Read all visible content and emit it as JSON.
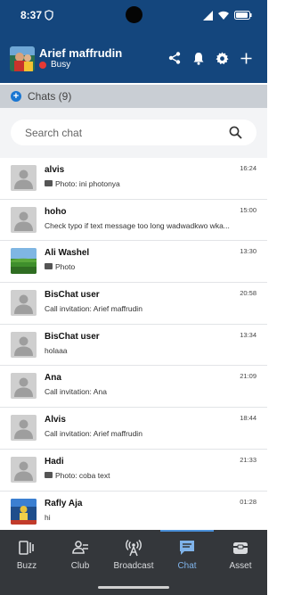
{
  "status_bar": {
    "time": "8:37",
    "battery_icon": "battery-icon",
    "wifi_icon": "wifi-icon",
    "signal_icon": "signal-icon"
  },
  "user": {
    "name": "Arief maffrudin",
    "presence": "Busy",
    "presence_color": "#e53935"
  },
  "app_bar_icons": [
    "share-icon",
    "bell-icon",
    "gear-icon",
    "plus-icon"
  ],
  "section": {
    "label": "Chats (9)"
  },
  "search": {
    "placeholder": "Search chat",
    "value": ""
  },
  "chats": [
    {
      "name": "alvis",
      "preview": "Photo: ini photonya",
      "time": "16:24",
      "has_photo_icon": true,
      "avatar": "default"
    },
    {
      "name": "hoho",
      "preview": "Check typo if text message too long wadwadkwo wka...",
      "time": "15:00",
      "has_photo_icon": false,
      "avatar": "default"
    },
    {
      "name": "Ali Washel",
      "preview": "Photo",
      "time": "13:30",
      "has_photo_icon": true,
      "avatar": "landscape"
    },
    {
      "name": "BisChat user",
      "preview": "Call invitation: Arief maffrudin",
      "time": "20:58",
      "has_photo_icon": false,
      "avatar": "default"
    },
    {
      "name": "BisChat user",
      "preview": "holaaa",
      "time": "13:34",
      "has_photo_icon": false,
      "avatar": "default"
    },
    {
      "name": "Ana",
      "preview": "Call invitation: Ana",
      "time": "21:09",
      "has_photo_icon": false,
      "avatar": "default"
    },
    {
      "name": "Alvis",
      "preview": "Call invitation: Arief maffrudin",
      "time": "18:44",
      "has_photo_icon": false,
      "avatar": "default"
    },
    {
      "name": "Hadi",
      "preview": "Photo: coba text",
      "time": "21:33",
      "has_photo_icon": true,
      "avatar": "default"
    },
    {
      "name": "Rafly Aja",
      "preview": "hi",
      "time": "01:28",
      "has_photo_icon": false,
      "avatar": "photo"
    }
  ],
  "bottom_nav": {
    "items": [
      {
        "label": "Buzz",
        "icon": "buzz-icon",
        "active": false
      },
      {
        "label": "Club",
        "icon": "club-icon",
        "active": false
      },
      {
        "label": "Broadcast",
        "icon": "broadcast-icon",
        "active": false
      },
      {
        "label": "Chat",
        "icon": "chat-icon",
        "active": true
      },
      {
        "label": "Asset",
        "icon": "asset-icon",
        "active": false
      }
    ]
  },
  "colors": {
    "header_bg": "#14467d",
    "section_bg": "#c9ced4",
    "nav_bg": "#34373b",
    "active_tab": "#7fb3ea"
  }
}
